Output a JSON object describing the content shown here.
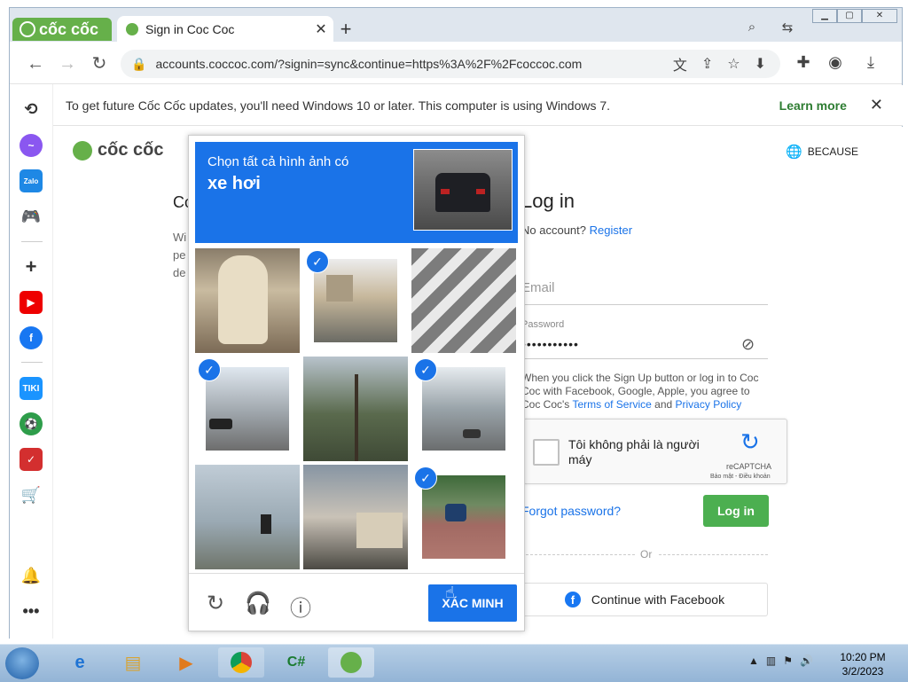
{
  "browser": {
    "brand_label": "cốc cốc",
    "tab_title": "Sign in Coc Coc",
    "url": "accounts.coccoc.com/?signin=sync&continue=https%3A%2F%2Fcoccoc.com"
  },
  "infobar": {
    "message": "To get future Cốc Cốc updates, you'll need Windows 10 or later. This computer is using Windows 7.",
    "learn_more": "Learn more"
  },
  "sidebar": {
    "items": [
      {
        "icon": "history-icon"
      },
      {
        "icon": "messenger-icon"
      },
      {
        "icon": "zalo-icon",
        "label": "Zalo"
      },
      {
        "icon": "game-icon"
      },
      {
        "icon": "add-icon"
      },
      {
        "icon": "youtube-icon"
      },
      {
        "icon": "facebook-icon"
      },
      {
        "icon": "tiki-icon",
        "label": "TIKI"
      },
      {
        "icon": "football-icon"
      },
      {
        "icon": "checklist-icon"
      },
      {
        "icon": "cart-icon"
      },
      {
        "icon": "bell-icon"
      },
      {
        "icon": "more-icon"
      }
    ]
  },
  "page": {
    "logo_text": "cốc cốc",
    "language": "BECAUSE",
    "left_title_fragment": "Co",
    "left_text_fragments": [
      "Wi",
      "pe",
      "de"
    ],
    "login_title": "Log in",
    "no_account": "No account?",
    "register": "Register",
    "email_placeholder": "Email",
    "password_label": "Password",
    "password_value": "•••••••••••",
    "terms_before": "When you click the Sign Up button or log in to Coc Coc with Facebook, Google, Apple, you agree to Coc Coc's",
    "terms_link": "Terms of Service",
    "terms_and": "and",
    "privacy_link": "Privacy Policy",
    "recaptcha_label": "Tôi không phải là người máy",
    "recaptcha_brand": "reCAPTCHA",
    "recaptcha_sub": "Bảo mật - Điều khoản",
    "forgot": "Forgot password?",
    "login_button": "Log in",
    "or": "Or",
    "facebook_button": "Continue with Facebook"
  },
  "captcha": {
    "instruction": "Chọn tất cả hình ảnh có",
    "target": "xe hơi",
    "verify_button": "XÁC MINH",
    "tiles": [
      {
        "content": "fire hydrant",
        "selected": false
      },
      {
        "content": "intersection",
        "selected": true
      },
      {
        "content": "crosswalk",
        "selected": false
      },
      {
        "content": "road with cars",
        "selected": true
      },
      {
        "content": "palm tree",
        "selected": false
      },
      {
        "content": "highway cars",
        "selected": true
      },
      {
        "content": "traffic light",
        "selected": false
      },
      {
        "content": "houses",
        "selected": false
      },
      {
        "content": "car on street",
        "selected": true
      }
    ]
  },
  "taskbar": {
    "time": "10:20 PM",
    "date": "3/2/2023"
  }
}
